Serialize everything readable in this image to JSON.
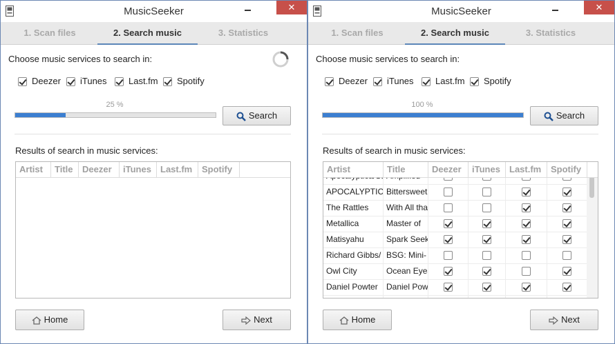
{
  "app": {
    "title": "MusicSeeker",
    "close_glyph": "✕"
  },
  "tabs": [
    {
      "label": "1. Scan files"
    },
    {
      "label": "2. Search music"
    },
    {
      "label": "3. Statistics"
    }
  ],
  "services_label": "Choose music services to search in:",
  "services": [
    {
      "label": "Deezer",
      "checked": true
    },
    {
      "label": "iTunes",
      "checked": true
    },
    {
      "label": "Last.fm",
      "checked": true
    },
    {
      "label": "Spotify",
      "checked": true
    }
  ],
  "search_button": "Search",
  "results_label": "Results of search in music services:",
  "columns": [
    "Artist",
    "Title",
    "Deezer",
    "iTunes",
    "Last.fm",
    "Spotify"
  ],
  "home_button": "Home",
  "next_button": "Next",
  "left": {
    "progress_text": "25 %",
    "progress": 0.25
  },
  "right": {
    "progress_text": "100 %",
    "progress": 1.0,
    "rows": [
      {
        "artist": "Apocalyptica/Sandra",
        "title": "Amplified",
        "deezer": false,
        "itunes": false,
        "lastfm": false,
        "spotify": false
      },
      {
        "artist": "APOCALYPTICA",
        "title": "Bittersweet",
        "deezer": false,
        "itunes": false,
        "lastfm": true,
        "spotify": true
      },
      {
        "artist": "The Rattles",
        "title": "With All that",
        "deezer": false,
        "itunes": false,
        "lastfm": true,
        "spotify": true
      },
      {
        "artist": "Metallica",
        "title": "Master of",
        "deezer": true,
        "itunes": true,
        "lastfm": true,
        "spotify": true
      },
      {
        "artist": "Matisyahu",
        "title": "Spark Seeker",
        "deezer": true,
        "itunes": true,
        "lastfm": true,
        "spotify": true
      },
      {
        "artist": "Richard Gibbs/",
        "title": "BSG: Mini-",
        "deezer": false,
        "itunes": false,
        "lastfm": false,
        "spotify": false
      },
      {
        "artist": "Owl City",
        "title": "Ocean Eyes",
        "deezer": true,
        "itunes": true,
        "lastfm": false,
        "spotify": true
      },
      {
        "artist": "Daniel Powter",
        "title": "Daniel Powter",
        "deezer": true,
        "itunes": true,
        "lastfm": true,
        "spotify": true
      },
      {
        "artist": "",
        "title": "",
        "deezer": false,
        "itunes": false,
        "lastfm": false,
        "spotify": false
      }
    ]
  }
}
